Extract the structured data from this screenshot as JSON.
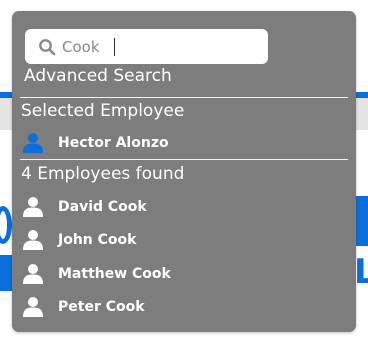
{
  "search": {
    "value": "Cook",
    "icon": "search-icon"
  },
  "advanced_search_label": "Advanced Search",
  "selected_section": {
    "title": "Selected Employee",
    "employee": {
      "name": "Hector Alonzo",
      "icon": "user-icon",
      "icon_color": "#0a6fdc"
    }
  },
  "results_section": {
    "title": "4 Employees found",
    "employees": [
      {
        "name": "David Cook",
        "icon": "user-icon"
      },
      {
        "name": "John Cook",
        "icon": "user-icon"
      },
      {
        "name": "Matthew Cook",
        "icon": "user-icon"
      },
      {
        "name": "Peter Cook",
        "icon": "user-icon"
      }
    ]
  },
  "colors": {
    "panel": "#7d7d7d",
    "accent": "#0a6fdc",
    "text": "#ffffff"
  }
}
